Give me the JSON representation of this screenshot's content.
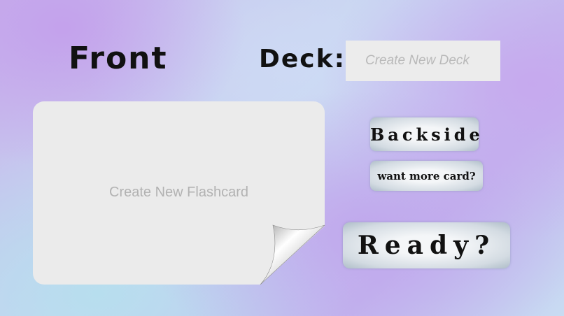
{
  "front": {
    "title": "Front"
  },
  "deck": {
    "label": "Deck:",
    "placeholder": "Create New Deck",
    "value": ""
  },
  "card": {
    "placeholder": "Create New Flashcard",
    "value": ""
  },
  "actions": {
    "backside_label": "Backside",
    "more_label": "want more card?",
    "ready_label": "Ready?"
  },
  "colors": {
    "card_background": "#ebebeb",
    "input_background": "#ececec",
    "text_dark": "#111111",
    "placeholder": "#b9b9b9"
  }
}
